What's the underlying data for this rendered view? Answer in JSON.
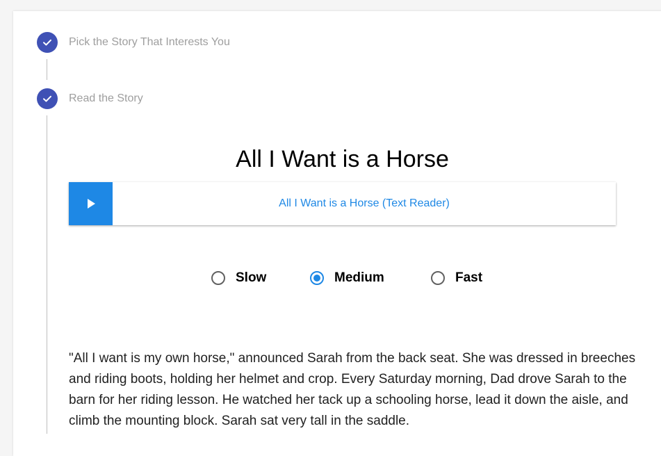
{
  "steps": [
    {
      "label": "Pick the Story That Interests You",
      "status": "completed"
    },
    {
      "label": "Read the Story",
      "status": "completed"
    }
  ],
  "story": {
    "title": "All I Want is a Horse",
    "player_label": "All I Want is a Horse (Text Reader)",
    "paragraph": "\"All I want is my own horse,\" announced Sarah from the back seat. She was dressed in breeches and riding boots, holding her helmet and crop. Every Saturday morning, Dad drove Sarah to the barn for her riding lesson. He watched her tack up a schooling horse, lead it down the aisle, and climb the mounting block. Sarah sat very tall in the saddle."
  },
  "speed": {
    "options": [
      "Slow",
      "Medium",
      "Fast"
    ],
    "selected": "Medium"
  },
  "colors": {
    "step_icon": "#3f51b5",
    "accent": "#1e88e5",
    "muted_text": "#9e9e9e"
  },
  "icons": {
    "step_done": "check-icon",
    "play": "play-icon"
  }
}
